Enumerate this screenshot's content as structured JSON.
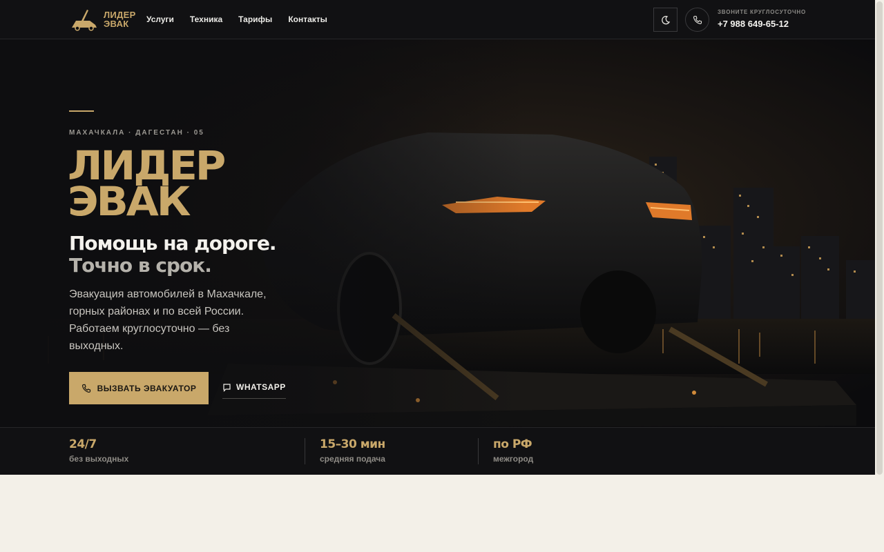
{
  "brand": {
    "line1": "ЛИДЕР",
    "line2": "ЭВАК"
  },
  "nav": [
    {
      "label": "Услуги"
    },
    {
      "label": "Техника"
    },
    {
      "label": "Тарифы"
    },
    {
      "label": "Контакты"
    }
  ],
  "contact": {
    "label": "ЗВОНИТЕ КРУГЛОСУТОЧНО",
    "phone": "+7 988 649-65-12"
  },
  "hero": {
    "eyebrow": "МАХАЧКАЛА · ДАГЕСТАН · 05",
    "title_line1": "ЛИДЕР",
    "title_line2": "ЭВАК",
    "tagline_line1": "Помощь на дороге.",
    "tagline_line2": "Точно в срок.",
    "description": "Эвакуация автомобилей в Махачкале, горных районах и по всей России. Работаем круглосуточно — без выходных.",
    "cta_label": "ВЫЗВАТЬ ЭВАКУАТОР",
    "whatsapp_label": "WHATSAPP"
  },
  "stats": [
    {
      "value": "24/7",
      "label": "без выходных"
    },
    {
      "value": "15–30 мин",
      "label": "средняя подача"
    },
    {
      "value": "по РФ",
      "label": "межгород"
    }
  ],
  "colors": {
    "accent": "#c9a86a",
    "background": "#0e0e10",
    "page_below": "#f3f0e8"
  },
  "icons": {
    "theme": "moon-icon",
    "phone": "phone-icon",
    "cta": "phone-icon",
    "whatsapp": "chat-bubble-icon"
  }
}
